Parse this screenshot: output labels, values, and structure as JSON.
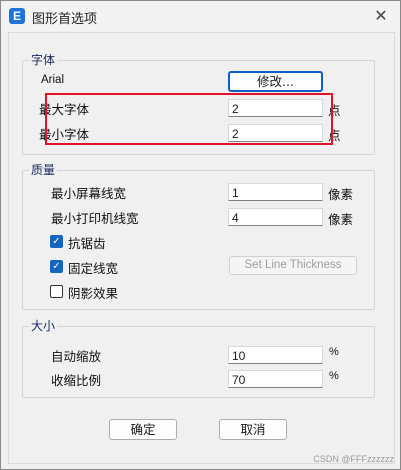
{
  "window": {
    "title": "图形首选项",
    "app_icon": "E",
    "close_glyph": "✕"
  },
  "font_group": {
    "label": "字体",
    "font_name": "Arial",
    "modify_button": "修改...",
    "max_size_label": "最大字体",
    "max_size_value": "2",
    "max_size_unit": "点",
    "min_size_label": "最小字体",
    "min_size_value": "2",
    "min_size_unit": "点"
  },
  "quality_group": {
    "label": "质量",
    "min_screen_line_label": "最小屏幕线宽",
    "min_screen_line_value": "1",
    "min_screen_line_unit": "像素",
    "min_print_line_label": "最小打印机线宽",
    "min_print_line_value": "4",
    "min_print_line_unit": "像素",
    "antialias_label": "抗锯齿",
    "antialias_checked": true,
    "fixed_width_label": "固定线宽",
    "fixed_width_checked": true,
    "set_line_thickness_button": "Set Line Thickness",
    "shadow_label": "阴影效果",
    "shadow_checked": false
  },
  "size_group": {
    "label": "大小",
    "auto_zoom_label": "自动缩放",
    "auto_zoom_value": "10",
    "auto_zoom_unit": "%",
    "shrink_ratio_label": "收缩比例",
    "shrink_ratio_value": "70",
    "shrink_ratio_unit": "%"
  },
  "footer": {
    "ok_button": "确定",
    "cancel_button": "取消"
  },
  "watermark": "CSDN @FFFzzzzzz",
  "colors": {
    "highlight": "#e3122b",
    "accent": "#1565c0"
  },
  "icons": {
    "app": "app-e-icon",
    "close": "close-icon",
    "check": "check-icon"
  }
}
